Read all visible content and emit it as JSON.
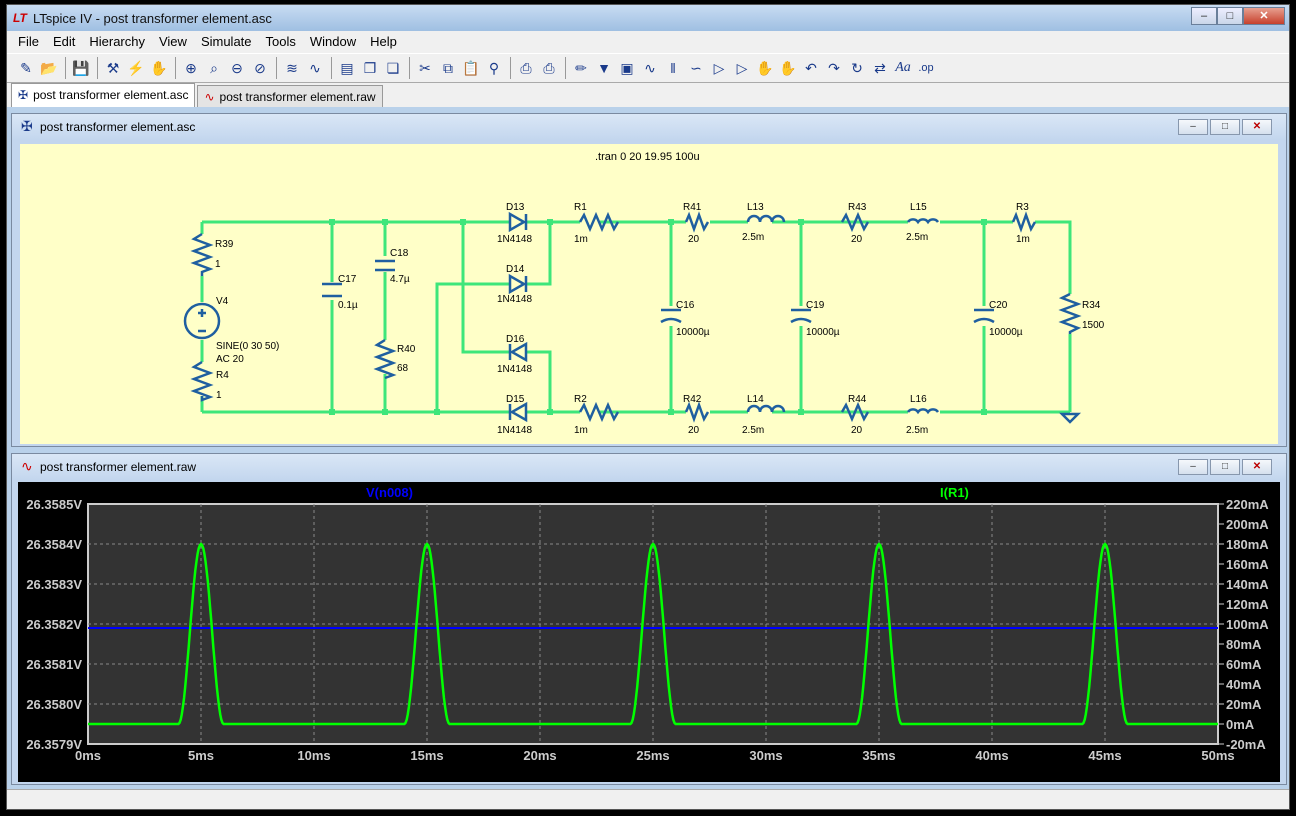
{
  "app": {
    "title": "LTspice IV - post transformer element.asc"
  },
  "menu": [
    "File",
    "Edit",
    "Hierarchy",
    "View",
    "Simulate",
    "Tools",
    "Window",
    "Help"
  ],
  "tabs": [
    {
      "label": "post transformer element.asc"
    },
    {
      "label": "post transformer element.raw"
    }
  ],
  "schematic": {
    "title": "post transformer element.asc",
    "directive": ".tran 0 20 19.95 100u",
    "components": {
      "R39": {
        "ref": "R39",
        "val": "1"
      },
      "V4": {
        "ref": "V4",
        "val": "SINE(0 30 50)",
        "ac": "AC 20"
      },
      "R4": {
        "ref": "R4",
        "val": "1"
      },
      "C17": {
        "ref": "C17",
        "val": "0.1µ"
      },
      "C18": {
        "ref": "C18",
        "val": "4.7µ"
      },
      "R40": {
        "ref": "R40",
        "val": "68"
      },
      "D13": {
        "ref": "D13",
        "val": "1N4148"
      },
      "D14": {
        "ref": "D14",
        "val": "1N4148"
      },
      "D16": {
        "ref": "D16",
        "val": "1N4148"
      },
      "D15": {
        "ref": "D15",
        "val": "1N4148"
      },
      "R1": {
        "ref": "R1",
        "val": "1m"
      },
      "R2": {
        "ref": "R2",
        "val": "1m"
      },
      "R41": {
        "ref": "R41",
        "val": "20"
      },
      "R42": {
        "ref": "R42",
        "val": "20"
      },
      "L13": {
        "ref": "L13",
        "val": "2.5m"
      },
      "L14": {
        "ref": "L14",
        "val": "2.5m"
      },
      "C16": {
        "ref": "C16",
        "val": "10000µ"
      },
      "C19": {
        "ref": "C19",
        "val": "10000µ"
      },
      "R43": {
        "ref": "R43",
        "val": "20"
      },
      "R44": {
        "ref": "R44",
        "val": "20"
      },
      "L15": {
        "ref": "L15",
        "val": "2.5m"
      },
      "L16": {
        "ref": "L16",
        "val": "2.5m"
      },
      "C20": {
        "ref": "C20",
        "val": "10000µ"
      },
      "R3": {
        "ref": "R3",
        "val": "1m"
      },
      "R34": {
        "ref": "R34",
        "val": "1500"
      }
    }
  },
  "waveform": {
    "title": "post transformer element.raw"
  },
  "chart_data": {
    "type": "line",
    "series": [
      {
        "name": "V(n008)",
        "color": "#0000ff",
        "axis": "left",
        "x": [
          0,
          50
        ],
        "y": [
          26.35819,
          26.35819
        ]
      },
      {
        "name": "I(R1)",
        "color": "#00ff00",
        "axis": "right",
        "shape": "periodic-pulse",
        "pulse_centers_ms": [
          5,
          15,
          25,
          35,
          45
        ],
        "peak": 0.18,
        "base": 0,
        "pulse_halfwidth_ms": 1.0
      }
    ],
    "xlim": [
      0,
      50
    ],
    "x_ticks": [
      "0ms",
      "5ms",
      "10ms",
      "15ms",
      "20ms",
      "25ms",
      "30ms",
      "35ms",
      "40ms",
      "45ms",
      "50ms"
    ],
    "ylim_left": [
      26.3579,
      26.3585
    ],
    "y_ticks_left": [
      "26.3579V",
      "26.3580V",
      "26.3581V",
      "26.3582V",
      "26.3583V",
      "26.3584V",
      "26.3585V"
    ],
    "ylim_right": [
      -0.02,
      0.22
    ],
    "y_ticks_right": [
      "-20mA",
      "0mA",
      "20mA",
      "40mA",
      "60mA",
      "80mA",
      "100mA",
      "120mA",
      "140mA",
      "160mA",
      "180mA",
      "200mA",
      "220mA"
    ],
    "grid": true
  }
}
